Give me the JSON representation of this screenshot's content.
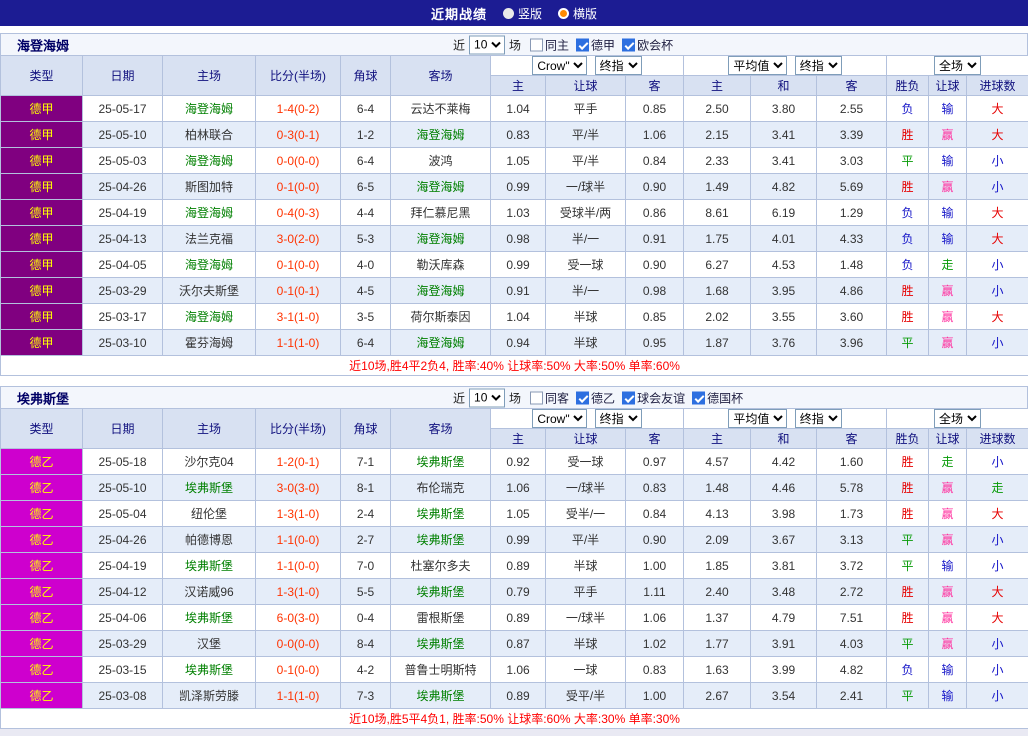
{
  "titlebar": {
    "title": "近期战绩",
    "options": [
      {
        "label": "竖版",
        "selected": false
      },
      {
        "label": "横版",
        "selected": true
      }
    ]
  },
  "columns": [
    "类型",
    "日期",
    "主场",
    "比分(半场)",
    "角球",
    "客场",
    "主",
    "让球",
    "客",
    "主",
    "和",
    "客",
    "胜负",
    "让球",
    "进球数"
  ],
  "colors": {
    "score": "#ff3300",
    "focus_team": "#008000",
    "league_text": "#ffff00",
    "summary": "#ff0000"
  },
  "result_colors": {
    "胜": "#e60000",
    "平": "#089b08",
    "负": "#1515c8",
    "赢": "#ff2f9e",
    "输": "#1515c8",
    "走": "#089b08",
    "大": "#e60000",
    "小": "#1515c8"
  },
  "tables": [
    {
      "team": "海登海姆",
      "league_color": "#800080",
      "filters": {
        "near": "近",
        "count": "10",
        "games": "场",
        "options": [
          {
            "label": "同主",
            "checked": false
          },
          {
            "label": "德甲",
            "checked": true
          },
          {
            "label": "欧会杯",
            "checked": true
          }
        ]
      },
      "selects": {
        "company": "Crow\"",
        "company_time": "终指",
        "average": "平均值",
        "average_time": "终指",
        "scope": "全场"
      },
      "rows": [
        {
          "league": "德甲",
          "date": "25-05-17",
          "home": "海登海姆",
          "hf": true,
          "score": "1-4(0-2)",
          "corner": "6-4",
          "away": "云达不莱梅",
          "af": false,
          "h": "1.04",
          "hc": "平手",
          "a": "0.85",
          "o1": "2.50",
          "ox": "3.80",
          "o2": "2.55",
          "r": "负",
          "ah": "输",
          "ou": "大"
        },
        {
          "league": "德甲",
          "date": "25-05-10",
          "home": "柏林联合",
          "hf": false,
          "score": "0-3(0-1)",
          "corner": "1-2",
          "away": "海登海姆",
          "af": true,
          "h": "0.83",
          "hc": "平/半",
          "a": "1.06",
          "o1": "2.15",
          "ox": "3.41",
          "o2": "3.39",
          "r": "胜",
          "ah": "赢",
          "ou": "大"
        },
        {
          "league": "德甲",
          "date": "25-05-03",
          "home": "海登海姆",
          "hf": true,
          "score": "0-0(0-0)",
          "corner": "6-4",
          "away": "波鸿",
          "af": false,
          "h": "1.05",
          "hc": "平/半",
          "a": "0.84",
          "o1": "2.33",
          "ox": "3.41",
          "o2": "3.03",
          "r": "平",
          "ah": "输",
          "ou": "小"
        },
        {
          "league": "德甲",
          "date": "25-04-26",
          "home": "斯图加特",
          "hf": false,
          "score": "0-1(0-0)",
          "corner": "6-5",
          "away": "海登海姆",
          "af": true,
          "h": "0.99",
          "hc": "一/球半",
          "a": "0.90",
          "o1": "1.49",
          "ox": "4.82",
          "o2": "5.69",
          "r": "胜",
          "ah": "赢",
          "ou": "小"
        },
        {
          "league": "德甲",
          "date": "25-04-19",
          "home": "海登海姆",
          "hf": true,
          "score": "0-4(0-3)",
          "corner": "4-4",
          "away": "拜仁慕尼黑",
          "af": false,
          "h": "1.03",
          "hc": "受球半/两",
          "a": "0.86",
          "o1": "8.61",
          "ox": "6.19",
          "o2": "1.29",
          "r": "负",
          "ah": "输",
          "ou": "大"
        },
        {
          "league": "德甲",
          "date": "25-04-13",
          "home": "法兰克福",
          "hf": false,
          "score": "3-0(2-0)",
          "corner": "5-3",
          "away": "海登海姆",
          "af": true,
          "h": "0.98",
          "hc": "半/一",
          "a": "0.91",
          "o1": "1.75",
          "ox": "4.01",
          "o2": "4.33",
          "r": "负",
          "ah": "输",
          "ou": "大"
        },
        {
          "league": "德甲",
          "date": "25-04-05",
          "home": "海登海姆",
          "hf": true,
          "score": "0-1(0-0)",
          "corner": "4-0",
          "away": "勒沃库森",
          "af": false,
          "h": "0.99",
          "hc": "受一球",
          "a": "0.90",
          "o1": "6.27",
          "ox": "4.53",
          "o2": "1.48",
          "r": "负",
          "ah": "走",
          "ou": "小"
        },
        {
          "league": "德甲",
          "date": "25-03-29",
          "home": "沃尔夫斯堡",
          "hf": false,
          "score": "0-1(0-1)",
          "corner": "4-5",
          "away": "海登海姆",
          "af": true,
          "h": "0.91",
          "hc": "半/一",
          "a": "0.98",
          "o1": "1.68",
          "ox": "3.95",
          "o2": "4.86",
          "r": "胜",
          "ah": "赢",
          "ou": "小"
        },
        {
          "league": "德甲",
          "date": "25-03-17",
          "home": "海登海姆",
          "hf": true,
          "score": "3-1(1-0)",
          "corner": "3-5",
          "away": "荷尔斯泰因",
          "af": false,
          "h": "1.04",
          "hc": "半球",
          "a": "0.85",
          "o1": "2.02",
          "ox": "3.55",
          "o2": "3.60",
          "r": "胜",
          "ah": "赢",
          "ou": "大"
        },
        {
          "league": "德甲",
          "date": "25-03-10",
          "home": "霍芬海姆",
          "hf": false,
          "score": "1-1(1-0)",
          "corner": "6-4",
          "away": "海登海姆",
          "af": true,
          "h": "0.94",
          "hc": "半球",
          "a": "0.95",
          "o1": "1.87",
          "ox": "3.76",
          "o2": "3.96",
          "r": "平",
          "ah": "赢",
          "ou": "小"
        }
      ],
      "summary": "近10场,胜4平2负4, 胜率:40% 让球率:50% 大率:50% 单率:60%"
    },
    {
      "team": "埃弗斯堡",
      "league_color": "#ce00ce",
      "filters": {
        "near": "近",
        "count": "10",
        "games": "场",
        "options": [
          {
            "label": "同客",
            "checked": false
          },
          {
            "label": "德乙",
            "checked": true
          },
          {
            "label": "球会友谊",
            "checked": true
          },
          {
            "label": "德国杯",
            "checked": true
          }
        ]
      },
      "selects": {
        "company": "Crow\"",
        "company_time": "终指",
        "average": "平均值",
        "average_time": "终指",
        "scope": "全场"
      },
      "rows": [
        {
          "league": "德乙",
          "date": "25-05-18",
          "home": "沙尔克04",
          "hf": false,
          "score": "1-2(0-1)",
          "corner": "7-1",
          "away": "埃弗斯堡",
          "af": true,
          "h": "0.92",
          "hc": "受一球",
          "a": "0.97",
          "o1": "4.57",
          "ox": "4.42",
          "o2": "1.60",
          "r": "胜",
          "ah": "走",
          "ou": "小"
        },
        {
          "league": "德乙",
          "date": "25-05-10",
          "home": "埃弗斯堡",
          "hf": true,
          "score": "3-0(3-0)",
          "corner": "8-1",
          "away": "布伦瑞克",
          "af": false,
          "h": "1.06",
          "hc": "一/球半",
          "a": "0.83",
          "o1": "1.48",
          "ox": "4.46",
          "o2": "5.78",
          "r": "胜",
          "ah": "赢",
          "ou": "走"
        },
        {
          "league": "德乙",
          "date": "25-05-04",
          "home": "纽伦堡",
          "hf": false,
          "score": "1-3(1-0)",
          "corner": "2-4",
          "away": "埃弗斯堡",
          "af": true,
          "h": "1.05",
          "hc": "受半/一",
          "a": "0.84",
          "o1": "4.13",
          "ox": "3.98",
          "o2": "1.73",
          "r": "胜",
          "ah": "赢",
          "ou": "大"
        },
        {
          "league": "德乙",
          "date": "25-04-26",
          "home": "帕德博恩",
          "hf": false,
          "score": "1-1(0-0)",
          "corner": "2-7",
          "away": "埃弗斯堡",
          "af": true,
          "h": "0.99",
          "hc": "平/半",
          "a": "0.90",
          "o1": "2.09",
          "ox": "3.67",
          "o2": "3.13",
          "r": "平",
          "ah": "赢",
          "ou": "小"
        },
        {
          "league": "德乙",
          "date": "25-04-19",
          "home": "埃弗斯堡",
          "hf": true,
          "score": "1-1(0-0)",
          "corner": "7-0",
          "away": "杜塞尔多夫",
          "af": false,
          "h": "0.89",
          "hc": "半球",
          "a": "1.00",
          "o1": "1.85",
          "ox": "3.81",
          "o2": "3.72",
          "r": "平",
          "ah": "输",
          "ou": "小"
        },
        {
          "league": "德乙",
          "date": "25-04-12",
          "home": "汉诺威96",
          "hf": false,
          "score": "1-3(1-0)",
          "corner": "5-5",
          "away": "埃弗斯堡",
          "af": true,
          "h": "0.79",
          "hc": "平手",
          "a": "1.11",
          "o1": "2.40",
          "ox": "3.48",
          "o2": "2.72",
          "r": "胜",
          "ah": "赢",
          "ou": "大"
        },
        {
          "league": "德乙",
          "date": "25-04-06",
          "home": "埃弗斯堡",
          "hf": true,
          "score": "6-0(3-0)",
          "corner": "0-4",
          "away": "雷根斯堡",
          "af": false,
          "h": "0.89",
          "hc": "一/球半",
          "a": "1.06",
          "o1": "1.37",
          "ox": "4.79",
          "o2": "7.51",
          "r": "胜",
          "ah": "赢",
          "ou": "大"
        },
        {
          "league": "德乙",
          "date": "25-03-29",
          "home": "汉堡",
          "hf": false,
          "score": "0-0(0-0)",
          "corner": "8-4",
          "away": "埃弗斯堡",
          "af": true,
          "h": "0.87",
          "hc": "半球",
          "a": "1.02",
          "o1": "1.77",
          "ox": "3.91",
          "o2": "4.03",
          "r": "平",
          "ah": "赢",
          "ou": "小"
        },
        {
          "league": "德乙",
          "date": "25-03-15",
          "home": "埃弗斯堡",
          "hf": true,
          "score": "0-1(0-0)",
          "corner": "4-2",
          "away": "普鲁士明斯特",
          "af": false,
          "h": "1.06",
          "hc": "一球",
          "a": "0.83",
          "o1": "1.63",
          "ox": "3.99",
          "o2": "4.82",
          "r": "负",
          "ah": "输",
          "ou": "小"
        },
        {
          "league": "德乙",
          "date": "25-03-08",
          "home": "凯泽斯劳滕",
          "hf": false,
          "score": "1-1(1-0)",
          "corner": "7-3",
          "away": "埃弗斯堡",
          "af": true,
          "h": "0.89",
          "hc": "受平/半",
          "a": "1.00",
          "o1": "2.67",
          "ox": "3.54",
          "o2": "2.41",
          "r": "平",
          "ah": "输",
          "ou": "小"
        }
      ],
      "summary": "近10场,胜5平4负1, 胜率:50% 让球率:60% 大率:30% 单率:30%"
    }
  ]
}
